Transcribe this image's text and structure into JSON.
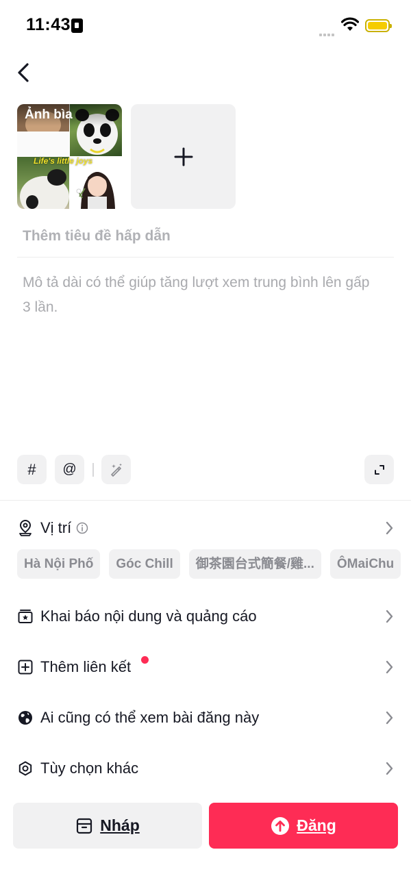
{
  "status_bar": {
    "time": "11:43"
  },
  "cover": {
    "label": "Ảnh bìa",
    "overlay_text": "Life's little joys"
  },
  "title_placeholder": "Thêm tiêu đề hấp dẫn",
  "description_placeholder": "Mô tả dài có thể giúp tăng lượt xem trung bình lên gấp 3 lần.",
  "toolbar": {
    "hashtag": "#",
    "mention": "@"
  },
  "location": {
    "label": "Vị trí",
    "chips": [
      "Hà Nội Phố",
      "Góc Chill",
      "御茶園台式簡餐/雞...",
      "ÔMaiChu"
    ]
  },
  "menu": {
    "disclosure": "Khai báo nội dung và quảng cáo",
    "add_link": "Thêm liên kết",
    "privacy": "Ai cũng có thể xem bài đăng này",
    "more_options": "Tùy chọn khác"
  },
  "buttons": {
    "draft": "Nháp",
    "post": "Đăng"
  },
  "colors": {
    "accent": "#fe2c55",
    "battery": "#f5cc00"
  },
  "icons": [
    "back-icon",
    "plus-icon",
    "hashtag-icon",
    "mention-icon",
    "magic-wand-icon",
    "expand-icon",
    "location-pin-icon",
    "info-icon",
    "chevron-right-icon",
    "ad-disclosure-icon",
    "add-link-icon",
    "globe-icon",
    "gear-icon",
    "draft-box-icon",
    "upload-arrow-icon"
  ]
}
